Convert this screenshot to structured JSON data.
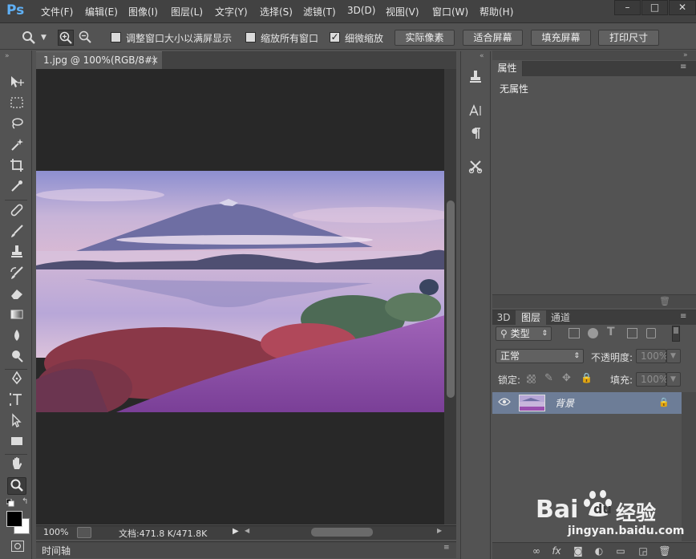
{
  "app": {
    "logo": "Ps"
  },
  "menu": [
    "文件(F)",
    "编辑(E)",
    "图像(I)",
    "图层(L)",
    "文字(Y)",
    "选择(S)",
    "滤镜(T)",
    "3D(D)",
    "视图(V)",
    "窗口(W)",
    "帮助(H)"
  ],
  "window_controls": {
    "minimize": "–",
    "maximize": "□",
    "close": "✕"
  },
  "options": {
    "checkbox1_label": "调整窗口大小以满屏显示",
    "checkbox1_checked": false,
    "checkbox2_label": "缩放所有窗口",
    "checkbox2_checked": false,
    "checkbox3_label": "细微缩放",
    "checkbox3_checked": true,
    "btn_actual": "实际像素",
    "btn_fit": "适合屏幕",
    "btn_fill": "填充屏幕",
    "btn_print": "打印尺寸"
  },
  "document": {
    "tab_title": "1.jpg @ 100%(RGB/8#)",
    "tab_close": "×",
    "zoom": "100%",
    "doc_info": "文档:471.8 K/471.8K",
    "timeline_label": "时间轴"
  },
  "properties": {
    "tab": "属性",
    "body": "无属性"
  },
  "layers": {
    "tabs": [
      "3D",
      "图层",
      "通道"
    ],
    "filter_label": "类型",
    "blend_mode": "正常",
    "opacity_label": "不透明度:",
    "opacity_value": "100%",
    "lock_label": "锁定:",
    "fill_label": "填充:",
    "fill_value": "100%",
    "layer_name": "背景"
  },
  "watermark": {
    "brand_bai": "Bai",
    "brand_du": "du",
    "brand_jy": "经验",
    "url": "jingyan.baidu.com"
  },
  "colors": {
    "ui_dark": "#282828",
    "panel": "#535353",
    "selected_layer": "#6d7d97",
    "ps_blue": "#5fb0f5"
  }
}
